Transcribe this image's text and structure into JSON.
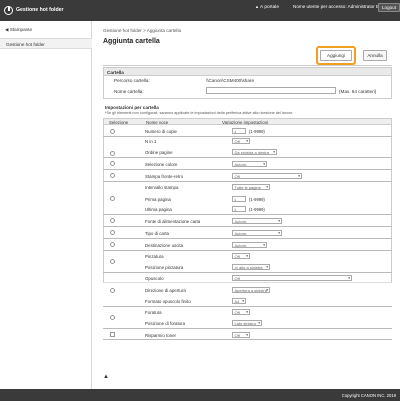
{
  "topbar": {
    "app_title": "Gestione hot folder",
    "portal_arrow": "▲",
    "portal": "A portale",
    "user_info": "Nome utente per accesso: Administrator Exit",
    "logout": "Logout"
  },
  "sidebar": {
    "back_arrow": "◀",
    "back": "Stampante",
    "item": "Gestione hot folder"
  },
  "breadcrumb": "Gestione hot folder > Aggiunta cartella",
  "page_title": "Aggiunta cartella",
  "buttons": {
    "add": "Aggiungi",
    "cancel": "Annulla"
  },
  "folder": {
    "section_title": "Cartella",
    "path_label": "Percorso cartella:",
    "path_value": "\\\\Canon\\CSM400\\share",
    "name_label": "Nome cartella:",
    "name_value": "",
    "name_hint": "(Max. 64 caratteri)"
  },
  "print_settings": {
    "section_title": "Impostazioni per cartella",
    "note": "*Se gli elementi non configurati, saranno applicate le impostazioni della periferica attive alla ricezione del lavoro.",
    "col_select": "Selezione",
    "col_name": "Nome voce",
    "col_value": "Variazione impostazioni",
    "rows": [
      {
        "label": "Numero di copie",
        "value": "1",
        "range": "(1-9999)"
      },
      {
        "label": "N in 1",
        "value": "Off"
      },
      {
        "label": "Ordine pagine",
        "value": "Da sinistra a destra"
      },
      {
        "label": "Selezione colore",
        "value": "Autom."
      },
      {
        "label": "Stampa fronte-retro",
        "value": "Off"
      },
      {
        "label": "Intervallo stampa",
        "value": "Tutte le pagine"
      },
      {
        "label": "Prima pagina",
        "value": "1",
        "range": "(1-9999)"
      },
      {
        "label": "Ultima pagina",
        "value": "1",
        "range": "(1-9999)"
      },
      {
        "label": "Fonte di alimentazione carta",
        "value": "Autom."
      },
      {
        "label": "Tipo di carta",
        "value": "Autom."
      },
      {
        "label": "Destinazione uscita",
        "value": "Autom."
      },
      {
        "label": "Pinzatura",
        "value": "Off"
      },
      {
        "label": "Posizione pinzatura",
        "value": "In alto a sinistra"
      },
      {
        "label": "Opuscolo",
        "value": "Off"
      },
      {
        "label": "Direzione di apertura",
        "value": "Apertura a sinistra"
      },
      {
        "label": "Formato opuscolo finito",
        "value": "A4"
      },
      {
        "label": "Foratura",
        "value": "Off"
      },
      {
        "label": "Posizione di foratura",
        "value": "Lato sinistro"
      },
      {
        "label": "Risparmio toner",
        "value": "Off"
      }
    ]
  },
  "back_to_top": "▲",
  "footer": "Copyright CANON INC. 2019",
  "icons": {
    "logo": "canon-logo-icon",
    "chevron": "chevron-down-icon"
  }
}
